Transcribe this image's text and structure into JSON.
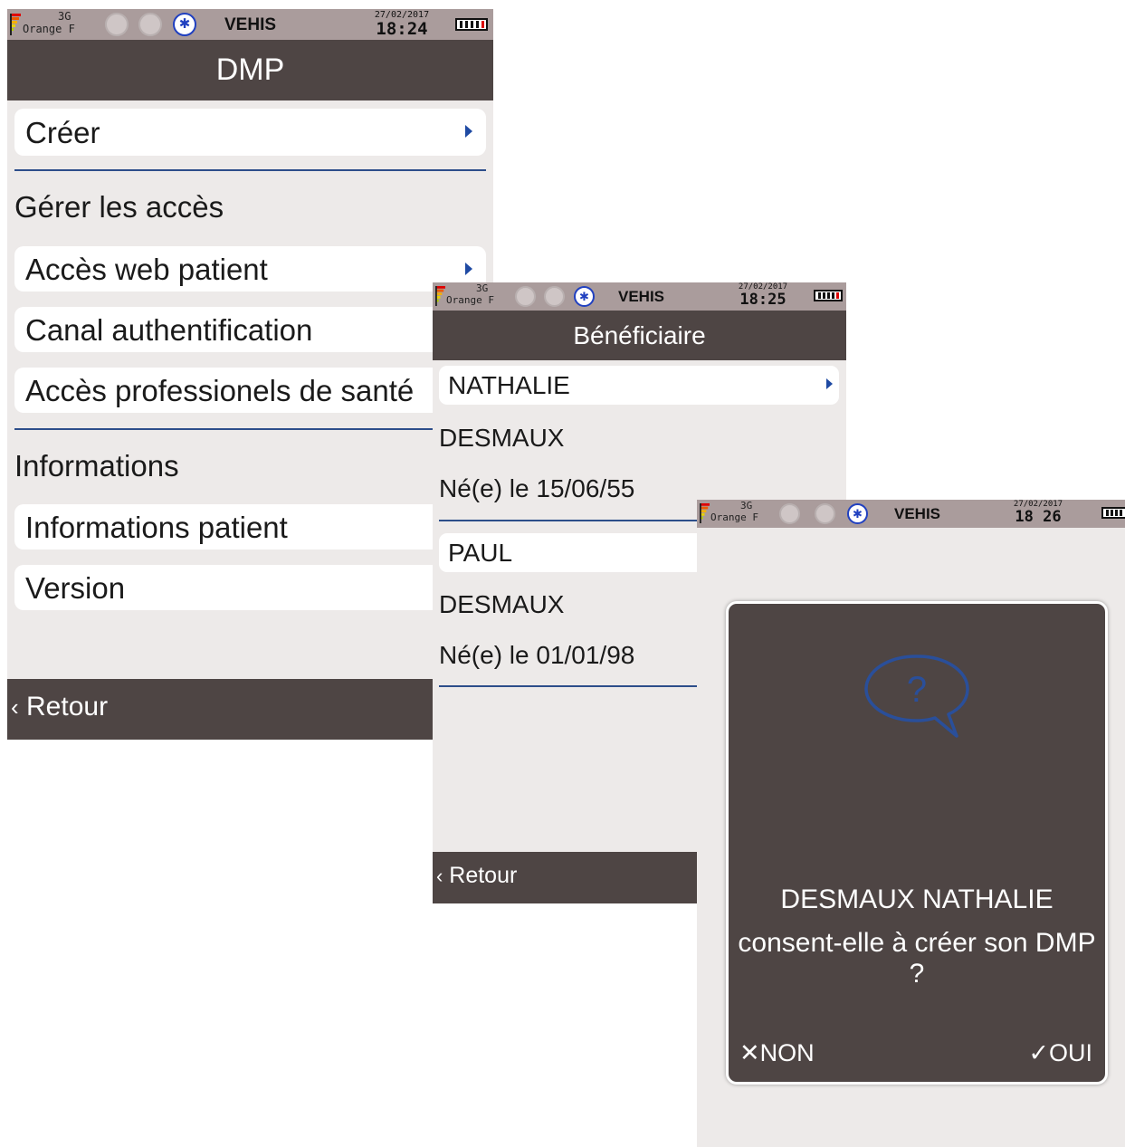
{
  "status": {
    "network": "3G",
    "carrier": "Orange F",
    "app_name": "VEHIS",
    "date": "27/02/2017"
  },
  "screen1": {
    "time": "18:24",
    "title": "DMP",
    "create_label": "Créer",
    "section_access": "Gérer les accès",
    "web_access_label": "Accès web patient",
    "auth_channel_label": "Canal authentification",
    "pro_access_label": "Accès professionels de santé",
    "section_info": "Informations",
    "patient_info_label": "Informations patient",
    "version_label": "Version",
    "back_label": "Retour"
  },
  "screen2": {
    "time": "18:25",
    "title": "Bénéficiaire",
    "beneficiaries": [
      {
        "first_name": "NATHALIE",
        "last_name": "DESMAUX",
        "birth": "Né(e) le 15/06/55"
      },
      {
        "first_name": "PAUL",
        "last_name": "DESMAUX",
        "birth": "Né(e) le 01/01/98"
      }
    ],
    "back_label": "Retour"
  },
  "screen3": {
    "time": "18 26",
    "dialog_line1": "DESMAUX NATHALIE",
    "dialog_line2": "consent-elle à créer son DMP ?",
    "no_label": "NON",
    "yes_label": "OUI"
  },
  "colors": {
    "status_bar": "#aa9c9c",
    "title_bar": "#4e4544",
    "background": "#edeae9",
    "separator": "#2d4e8a",
    "accent_blue": "#1f4aa3"
  }
}
